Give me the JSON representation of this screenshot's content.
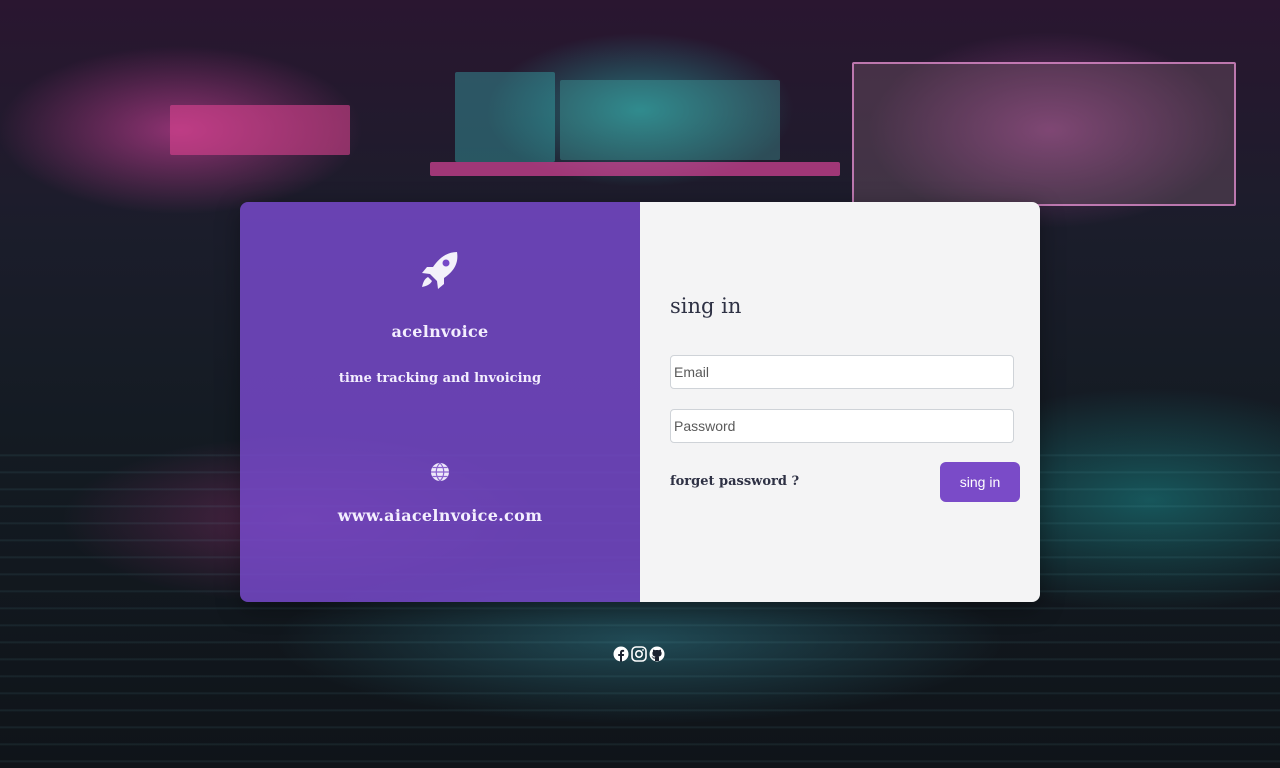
{
  "brand": {
    "icon": "rocket-icon",
    "name": "acelnvoice",
    "tagline": "time tracking and lnvoicing",
    "website_icon": "globe-icon",
    "website": "www.aiacelnvoice.com"
  },
  "form": {
    "title": "sing in",
    "email_placeholder": "Email",
    "password_placeholder": "Password",
    "forget_label": "forget password ?",
    "submit_label": "sing in"
  },
  "social": {
    "icons": [
      "facebook-icon",
      "instagram-icon",
      "github-icon"
    ]
  },
  "colors": {
    "accent": "#7a4bc8",
    "panel": "#f4f4f5",
    "text_dark": "#2e3144"
  }
}
